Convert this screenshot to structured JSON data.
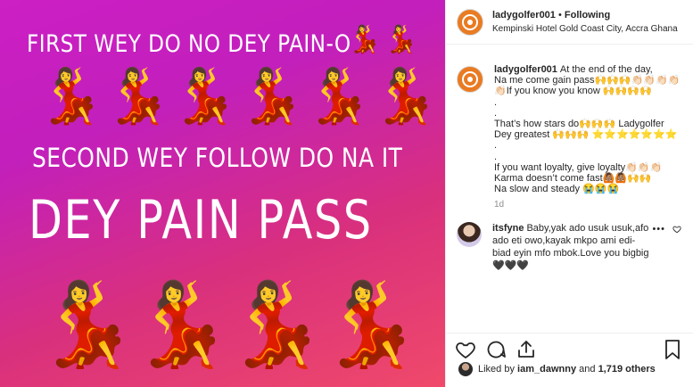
{
  "post": {
    "image_text": {
      "line1": "FIRST WEY DO NO DEY PAIN-O",
      "line2": "SECOND WEY FOLLOW DO NA IT",
      "line3": "DEY PAIN PASS"
    },
    "emoji": "💃"
  },
  "header": {
    "username": "ladygolfer001",
    "separator": " • ",
    "follow_state": "Following",
    "location": "Kempinski Hotel Gold Coast City, Accra Ghana"
  },
  "caption": {
    "username": "ladygolfer001",
    "lines": [
      "At the end of the day,",
      "Na me come gain pass🙌🙌🙌👏🏻👏🏻👏🏻👏🏻",
      "👏🏻If you know you know 🙌🙌🙌🙌",
      ".",
      ".",
      "That’s how stars do🙌🙌🙌 Ladygolfer",
      "Dey greatest 🙌🙌🙌 ⭐️⭐️⭐️⭐️⭐️⭐️⭐️",
      ".",
      ".",
      "If you want loyalty, give loyalty👏🏻👏🏻👏🏻",
      "Karma doesn’t come fast🙆🏽🙆🏽🙌🙌",
      "Na slow and steady 😭😭😭"
    ],
    "time_ago": "1d"
  },
  "comment": {
    "username": "itsfyne",
    "text": "Baby,yak ado usuk usuk,afo ado eti owo,kayak mkpo ami edi-biad eyin mfo mbok.Love you bigbig🖤🖤🖤",
    "more": "•••"
  },
  "likes": {
    "prefix": "Liked by",
    "user": "iam_dawnny",
    "conjunction": "and",
    "count": "1,719 others"
  }
}
